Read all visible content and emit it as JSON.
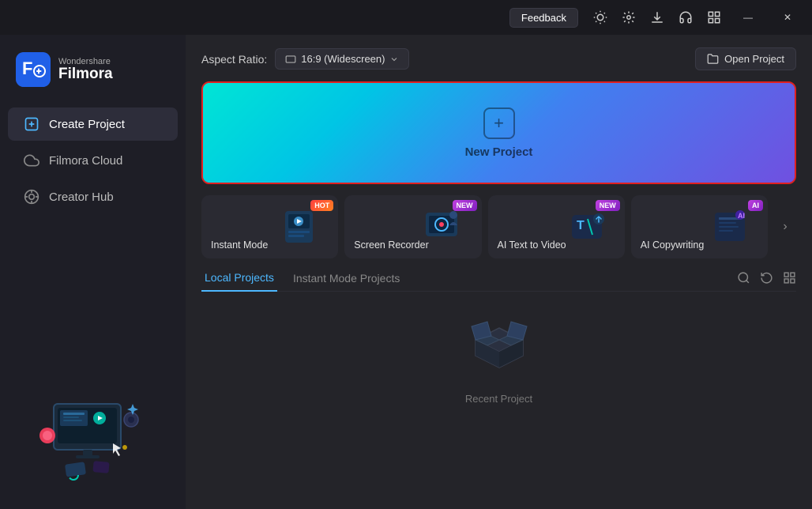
{
  "titlebar": {
    "feedback_label": "Feedback",
    "minimize_label": "—",
    "close_label": "✕"
  },
  "logo": {
    "wondershare": "Wondershare",
    "filmora": "Filmora"
  },
  "sidebar": {
    "nav_items": [
      {
        "id": "create-project",
        "label": "Create Project",
        "active": true
      },
      {
        "id": "filmora-cloud",
        "label": "Filmora Cloud",
        "active": false
      },
      {
        "id": "creator-hub",
        "label": "Creator Hub",
        "active": false
      }
    ]
  },
  "topbar": {
    "aspect_ratio_label": "Aspect Ratio:",
    "aspect_ratio_value": "16:9 (Widescreen)",
    "open_project_label": "Open Project"
  },
  "new_project": {
    "label": "New Project"
  },
  "feature_cards": [
    {
      "id": "instant-mode",
      "label": "Instant Mode",
      "badge": "HOT",
      "badge_type": "hot"
    },
    {
      "id": "screen-recorder",
      "label": "Screen Recorder",
      "badge": "NEW",
      "badge_type": "new"
    },
    {
      "id": "ai-text-to-video",
      "label": "AI Text to Video",
      "badge": "NEW",
      "badge_type": "new"
    },
    {
      "id": "ai-copywriting",
      "label": "AI Copywriting",
      "badge": "AI",
      "badge_type": "new"
    }
  ],
  "projects": {
    "tabs": [
      {
        "id": "local-projects",
        "label": "Local Projects",
        "active": true
      },
      {
        "id": "instant-mode-projects",
        "label": "Instant Mode Projects",
        "active": false
      }
    ],
    "empty_label": "Recent Project"
  }
}
